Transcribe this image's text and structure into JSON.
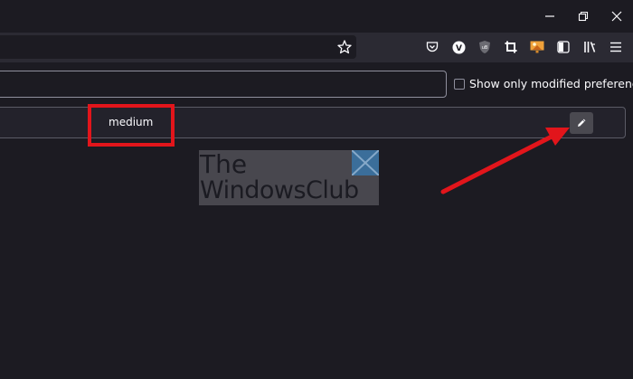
{
  "window": {
    "minimize_icon": "minimize-icon",
    "restore_icon": "restore-icon",
    "close_icon": "close-icon"
  },
  "toolbar": {
    "bookmark_icon": "star-icon",
    "extensions": [
      "pocket-icon",
      "vivaldi-v-icon",
      "ublock-icon",
      "crop-icon",
      "image-extension-icon",
      "reader-view-icon",
      "library-icon",
      "menu-icon"
    ]
  },
  "about_config": {
    "search_placeholder": "",
    "show_modified_label": "Show only modified preferences",
    "show_modified_checked": false,
    "pref_value": "medium"
  },
  "watermark": {
    "line1": "The",
    "line2": "WindowsClub"
  },
  "colors": {
    "background": "#1c1b22",
    "toolbar": "#2b2a33",
    "annotation_red": "#e2151b"
  }
}
